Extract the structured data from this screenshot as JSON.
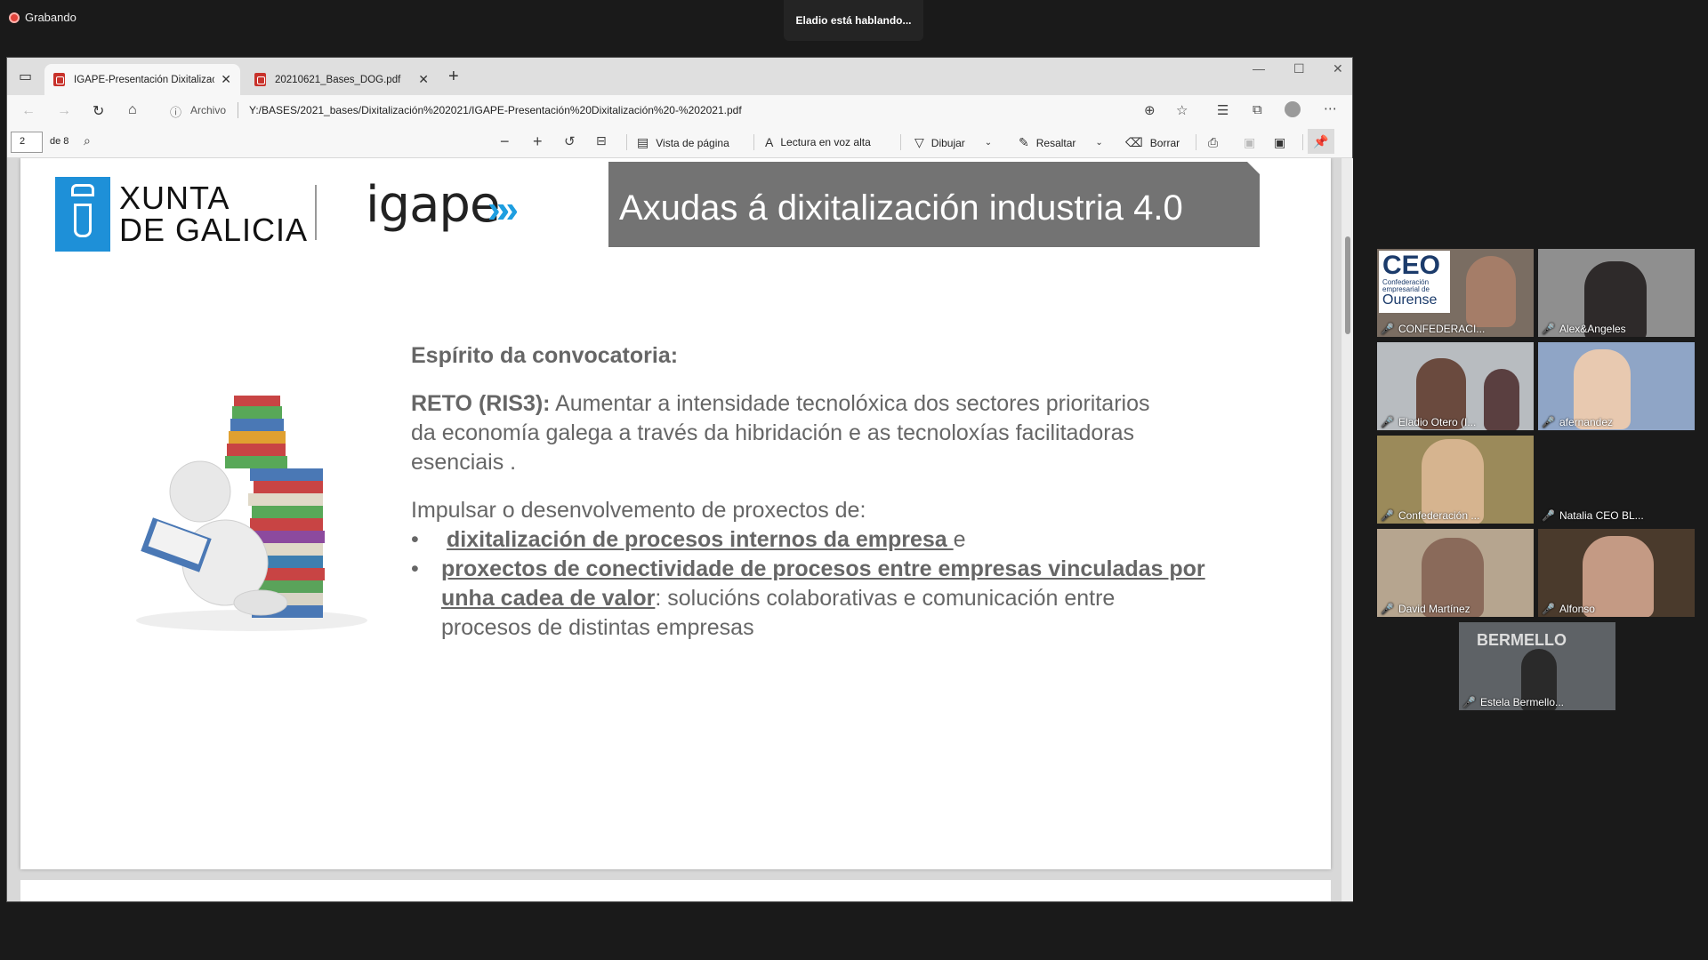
{
  "recording": {
    "label": "Grabando"
  },
  "speaker": {
    "text": "Eladio está hablando..."
  },
  "browser": {
    "tabs": [
      {
        "label": "IGAPE-Presentación Dixitalización",
        "active": true
      },
      {
        "label": "20210621_Bases_DOG.pdf",
        "active": false
      }
    ],
    "new_tab": "+",
    "site_info": "Archivo",
    "url": "Y:/BASES/2021_bases/Dixitalización%202021/IGAPE-Presentación%20Dixitalización%20-%202021.pdf"
  },
  "pdf_toolbar": {
    "page": "2",
    "of_pages": "de 8",
    "page_view": "Vista de página",
    "read_aloud": "Lectura en voz alta",
    "draw": "Dibujar",
    "highlight": "Resaltar",
    "erase": "Borrar"
  },
  "slide": {
    "logo_xunta": [
      "XUNTA",
      "DE GALICIA"
    ],
    "logo_igape": "igape",
    "title": "Axudas á dixitalización industria 4.0",
    "heading": "Espírito da convocatoria:",
    "reto_label": "RETO (RIS3):",
    "reto_line1": " Aumentar a intensidade  tecnolóxica dos sectores prioritarios",
    "reto_line2": "da economía galega a través da hibridación e as tecnoloxías facilitadoras",
    "reto_line3": "esenciais .",
    "impulsar": "Impulsar o desenvolvemento de proxectos de:",
    "bullet1_bold": "dixitalización de procesos internos da empresa ",
    "bullet1_rest": "e",
    "bullet2_bold_a": "proxectos de conectividade de procesos entre empresas vinculadas por",
    "bullet2_bold_b": "unha cadea de valor",
    "bullet2_rest_b": ": solucións colaborativas e comunicación entre",
    "bullet2_line3": "procesos de distintas empresas",
    "bullet_glyph": "•"
  },
  "participants": [
    {
      "name": "CONFEDERACI...",
      "muted": true
    },
    {
      "name": "Alex&Angeles",
      "muted": true
    },
    {
      "name": "Eladio Otero (I...",
      "muted": true
    },
    {
      "name": "afernandez",
      "muted": true
    },
    {
      "name": "Confederación ...",
      "muted": true
    },
    {
      "name": "Natalia CEO BL...",
      "muted": true
    },
    {
      "name": "David Martínez",
      "muted": true
    },
    {
      "name": "Alfonso",
      "muted": true
    },
    {
      "name": "Estela Bermello...",
      "muted": true
    }
  ],
  "ceo_logo": {
    "big": "CEO",
    "line1": "Confederación",
    "line2": "empresarial de",
    "line3": "Ourense"
  },
  "bermello_logo": "BERMELLO",
  "colors": {
    "accent_blue": "#1e90d8",
    "title_bg": "#737373",
    "text_gray": "#666666",
    "mic_red": "#e03c3c"
  }
}
